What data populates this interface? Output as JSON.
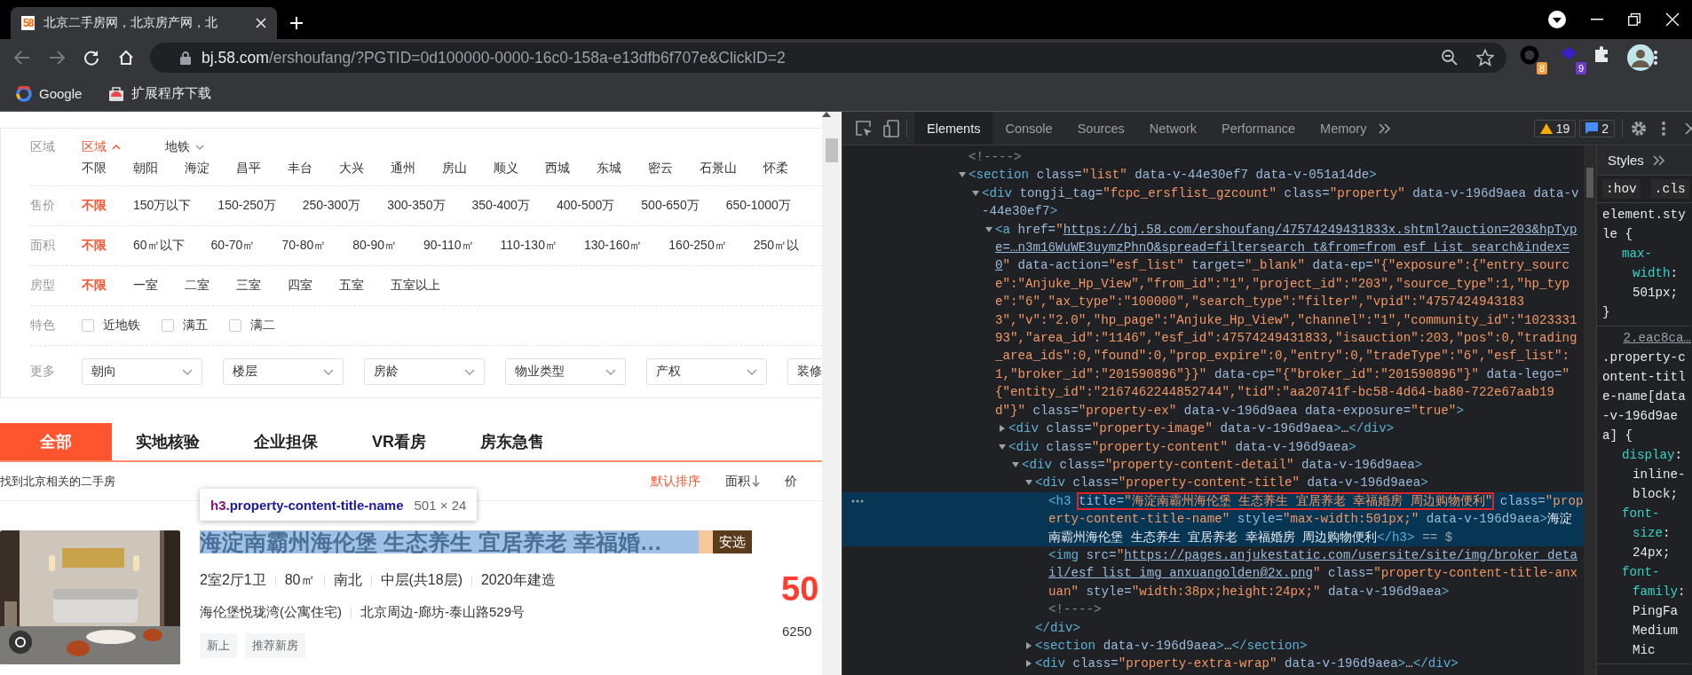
{
  "browser": {
    "tab": {
      "favicon_text": "58",
      "title": "北京二手房网，北京房产网，北"
    },
    "url": {
      "host": "bj.58.com",
      "path": "/ershoufang/?PGTID=0d100000-0000-16c0-158a-e13dfb6f707e&ClickID=2"
    },
    "extension_badges": [
      "8",
      "9"
    ],
    "bookmarks": [
      {
        "label": "Google",
        "kind": "google"
      },
      {
        "label": "扩展程序下载",
        "kind": "store"
      }
    ]
  },
  "filters": [
    {
      "label": "区域",
      "kind": "region",
      "tabs": [
        {
          "label": "区域",
          "selected": true
        },
        {
          "label": "地铁",
          "selected": false
        }
      ],
      "options": [
        {
          "label": "不限",
          "selected": false
        },
        {
          "label": "朝阳",
          "selected": false
        },
        {
          "label": "海淀",
          "selected": false
        },
        {
          "label": "昌平",
          "selected": false
        },
        {
          "label": "丰台",
          "selected": false
        },
        {
          "label": "大兴",
          "selected": false
        },
        {
          "label": "通州",
          "selected": false
        },
        {
          "label": "房山",
          "selected": false
        },
        {
          "label": "顺义",
          "selected": false
        },
        {
          "label": "西城",
          "selected": false
        },
        {
          "label": "东城",
          "selected": false
        },
        {
          "label": "密云",
          "selected": false
        },
        {
          "label": "石景山",
          "selected": false
        },
        {
          "label": "怀柔",
          "selected": false
        }
      ]
    },
    {
      "label": "售价",
      "kind": "options",
      "options": [
        {
          "label": "不限",
          "selected": true
        },
        {
          "label": "150万以下",
          "selected": false
        },
        {
          "label": "150-250万",
          "selected": false
        },
        {
          "label": "250-300万",
          "selected": false
        },
        {
          "label": "300-350万",
          "selected": false
        },
        {
          "label": "350-400万",
          "selected": false
        },
        {
          "label": "400-500万",
          "selected": false
        },
        {
          "label": "500-650万",
          "selected": false
        },
        {
          "label": "650-1000万",
          "selected": false
        }
      ]
    },
    {
      "label": "面积",
      "kind": "options",
      "options": [
        {
          "label": "不限",
          "selected": true
        },
        {
          "label": "60㎡以下",
          "selected": false
        },
        {
          "label": "60-70㎡",
          "selected": false
        },
        {
          "label": "70-80㎡",
          "selected": false
        },
        {
          "label": "80-90㎡",
          "selected": false
        },
        {
          "label": "90-110㎡",
          "selected": false
        },
        {
          "label": "110-130㎡",
          "selected": false
        },
        {
          "label": "130-160㎡",
          "selected": false
        },
        {
          "label": "160-250㎡",
          "selected": false
        },
        {
          "label": "250㎡以",
          "selected": false
        }
      ]
    },
    {
      "label": "房型",
      "kind": "options",
      "options": [
        {
          "label": "不限",
          "selected": true
        },
        {
          "label": "一室",
          "selected": false
        },
        {
          "label": "二室",
          "selected": false
        },
        {
          "label": "三室",
          "selected": false
        },
        {
          "label": "四室",
          "selected": false
        },
        {
          "label": "五室",
          "selected": false
        },
        {
          "label": "五室以上",
          "selected": false
        }
      ]
    },
    {
      "label": "特色",
      "kind": "checks",
      "options": [
        {
          "label": "近地铁",
          "checked": false
        },
        {
          "label": "满五",
          "checked": false
        },
        {
          "label": "满二",
          "checked": false
        }
      ]
    },
    {
      "label": "更多",
      "kind": "dropdowns",
      "options": [
        {
          "label": "朝向",
          "chevron": true
        },
        {
          "label": "楼层",
          "chevron": true
        },
        {
          "label": "房龄",
          "chevron": true
        },
        {
          "label": "物业类型",
          "chevron": true
        },
        {
          "label": "产权",
          "chevron": true
        },
        {
          "label": "装修"
        }
      ]
    }
  ],
  "list_tabs": [
    {
      "label": "全部",
      "selected": true
    },
    {
      "label": "实地核验",
      "selected": false
    },
    {
      "label": "企业担保",
      "selected": false
    },
    {
      "label": "VR看房",
      "selected": false
    },
    {
      "label": "房东急售",
      "selected": false
    }
  ],
  "sort_bar": {
    "summary": "找到北京相关的二手房",
    "sorts": [
      {
        "label": "默认排序",
        "selected": true,
        "kind": "plain"
      },
      {
        "label": "面积",
        "selected": false,
        "kind": "arrow"
      },
      {
        "label": "价",
        "selected": false,
        "kind": "plain"
      }
    ]
  },
  "inspect_tooltip": {
    "tag": "h3",
    "selector": ".property-content-title-name",
    "size": "501 × 24"
  },
  "listing": {
    "image": {
      "kind": "picture"
    },
    "title": "海淀南霸州海伦堡 生态养生 宜居养老 幸福婚…",
    "badge": "安选",
    "details": [
      "2室2厅1卫",
      "80㎡",
      "南北",
      "中层(共18层)",
      "2020年建造"
    ],
    "address": [
      "海伦堡悦珑湾(公寓住宅)",
      "北京周边-廊坊-泰山路529号"
    ],
    "tags": [
      "新上",
      "推荐新房"
    ],
    "price": "50",
    "unit_price": "6250"
  },
  "devtools": {
    "tabs": [
      {
        "label": "Elements",
        "selected": true
      },
      {
        "label": "Console",
        "selected": false
      },
      {
        "label": "Sources",
        "selected": false
      },
      {
        "label": "Network",
        "selected": false
      },
      {
        "label": "Performance",
        "selected": false
      },
      {
        "label": "Memory",
        "selected": false
      }
    ],
    "warnings": "19",
    "messages": "2",
    "dom": [
      {
        "segs": [
          {
            "kind": "comment",
            "text": "<!---->"
          }
        ],
        "selected": false
      },
      {
        "segs": [
          {
            "kind": "tag",
            "text": "<section"
          },
          {
            "kind": "attr",
            "text": " class="
          },
          {
            "kind": "value",
            "text": "\"list\""
          },
          {
            "kind": "attr",
            "text": " data-v-44e30ef7 data-v-051a14de"
          },
          {
            "kind": "tag",
            "text": ">"
          }
        ],
        "selected": false,
        "expanded": true,
        "children": [
          {
            "segs": [
              {
                "kind": "tag",
                "text": "<div"
              },
              {
                "kind": "attr",
                "text": " tongji_tag="
              },
              {
                "kind": "value",
                "text": "\"fcpc_ersflist_gzcount\""
              },
              {
                "kind": "attr",
                "text": " class="
              },
              {
                "kind": "value",
                "text": "\"property\""
              },
              {
                "kind": "attr",
                "text": " data-v-196d9aea data-v-44e30ef7"
              },
              {
                "kind": "tag",
                "text": ">"
              }
            ],
            "selected": false,
            "expanded": true,
            "children": [
              {
                "segs": [
                  {
                    "kind": "tag",
                    "text": "<a"
                  },
                  {
                    "kind": "attr",
                    "text": " href="
                  },
                  {
                    "kind": "value",
                    "text": "\""
                  },
                  {
                    "kind": "link",
                    "text": "https://bj.58.com/ershoufang/47574249431833x.shtml?auction=203&hpType=…n3m16WuWE3uymzPhnO&spread=filtersearch_t&from=from_esf_List_search&index=0"
                  },
                  {
                    "kind": "value",
                    "text": "\""
                  },
                  {
                    "kind": "attr",
                    "text": " data-action="
                  },
                  {
                    "kind": "value",
                    "text": "\"esf_list\""
                  },
                  {
                    "kind": "attr",
                    "text": " target="
                  },
                  {
                    "kind": "value",
                    "text": "\"_blank\""
                  },
                  {
                    "kind": "attr",
                    "text": " data-ep="
                  },
                  {
                    "kind": "value",
                    "text": "\"{\"exposure\":{\"entry_source\":\"Anjuke_Hp_View\",\"from_id\":\"1\",\"project_id\":\"203\",\"source_type\":1,\"hp_type\":\"6\",\"ax_type\":\"100000\",\"search_type\":\"filter\",\"vpid\":\"47574249431833\",\"v\":\"2.0\",\"hp_page\":\"Anjuke_Hp_View\",\"channel\":\"1\",\"community_id\":\"102333193\",\"area_id\":\"1146\",\"esf_id\":47574249431833,\"isauction\":203,\"pos\":0,\"trading_area_ids\":0,\"found\":0,\"prop_expire\":0,\"entry\":0,\"tradeType\":\"6\",\"esf_list\":1,\"broker_id\":\"201590896\"}}\""
                  },
                  {
                    "kind": "attr",
                    "text": " data-cp="
                  },
                  {
                    "kind": "value",
                    "text": "\"{\"broker_id\":\"201590896\"}\""
                  },
                  {
                    "kind": "attr",
                    "text": " data-lego="
                  },
                  {
                    "kind": "value",
                    "text": "\"{\"entity_id\":\"2167462244852744\",\"tid\":\"aa20741f-bc58-4d64-ba80-722e67aab19d\"}\""
                  },
                  {
                    "kind": "attr",
                    "text": " class="
                  },
                  {
                    "kind": "value",
                    "text": "\"property-ex\""
                  },
                  {
                    "kind": "attr",
                    "text": " data-v-196d9aea data-exposure="
                  },
                  {
                    "kind": "value",
                    "text": "\"true\""
                  },
                  {
                    "kind": "tag",
                    "text": ">"
                  }
                ],
                "selected": false,
                "expanded": true,
                "children": [
                  {
                    "segs": [
                      {
                        "kind": "tag",
                        "text": "<div"
                      },
                      {
                        "kind": "attr",
                        "text": " class="
                      },
                      {
                        "kind": "value",
                        "text": "\"property-image\""
                      },
                      {
                        "kind": "attr",
                        "text": " data-v-196d9aea"
                      },
                      {
                        "kind": "tag",
                        "text": ">"
                      },
                      {
                        "kind": "text",
                        "text": "…"
                      },
                      {
                        "kind": "tag",
                        "text": "</div>"
                      }
                    ],
                    "selected": false,
                    "expanded": false
                  },
                  {
                    "segs": [
                      {
                        "kind": "tag",
                        "text": "<div"
                      },
                      {
                        "kind": "attr",
                        "text": " class="
                      },
                      {
                        "kind": "value",
                        "text": "\"property-content\""
                      },
                      {
                        "kind": "attr",
                        "text": " data-v-196d9aea"
                      },
                      {
                        "kind": "tag",
                        "text": ">"
                      }
                    ],
                    "selected": false,
                    "expanded": true,
                    "children": [
                      {
                        "segs": [
                          {
                            "kind": "tag",
                            "text": "<div"
                          },
                          {
                            "kind": "attr",
                            "text": " class="
                          },
                          {
                            "kind": "value",
                            "text": "\"property-content-detail\""
                          },
                          {
                            "kind": "attr",
                            "text": " data-v-196d9aea"
                          },
                          {
                            "kind": "tag",
                            "text": ">"
                          }
                        ],
                        "selected": false,
                        "expanded": true,
                        "children": [
                          {
                            "segs": [
                              {
                                "kind": "tag",
                                "text": "<div"
                              },
                              {
                                "kind": "attr",
                                "text": " class="
                              },
                              {
                                "kind": "value",
                                "text": "\"property-content-title\""
                              },
                              {
                                "kind": "attr",
                                "text": " data-v-196d9aea"
                              },
                              {
                                "kind": "tag",
                                "text": ">"
                              }
                            ],
                            "selected": false,
                            "expanded": true,
                            "close": [
                              {
                                "kind": "tag",
                                "text": "</div>"
                              }
                            ],
                            "children": [
                              {
                                "segs": [
                                  {
                                    "kind": "tag",
                                    "text": "<h3 "
                                  },
                                  {
                                    "kind": "box",
                                    "parts": [
                                      {
                                        "kind": "attr",
                                        "text": "title="
                                      },
                                      {
                                        "kind": "value",
                                        "text": "\"海淀南霸州海伦堡 生态养生 宜居养老 幸福婚房 周边购物便利\""
                                      }
                                    ]
                                  },
                                  {
                                    "kind": "attr",
                                    "text": " class="
                                  },
                                  {
                                    "kind": "value",
                                    "text": "\"property-content-title-name\""
                                  },
                                  {
                                    "kind": "attr",
                                    "text": " style="
                                  },
                                  {
                                    "kind": "value",
                                    "text": "\"max-width:501px;\""
                                  },
                                  {
                                    "kind": "attr",
                                    "text": " data-v-196d9aea"
                                  },
                                  {
                                    "kind": "tag",
                                    "text": ">"
                                  },
                                  {
                                    "kind": "text",
                                    "text": "海淀南霸州海伦堡 生态养生 宜居养老 幸福婚房 周边购物便利"
                                  },
                                  {
                                    "kind": "tag",
                                    "text": "</h3>"
                                  },
                                  {
                                    "kind": "hint",
                                    "text": " == $"
                                  }
                                ],
                                "selected": true
                              },
                              {
                                "segs": [
                                  {
                                    "kind": "tag",
                                    "text": "<img"
                                  },
                                  {
                                    "kind": "attr",
                                    "text": " src="
                                  },
                                  {
                                    "kind": "value",
                                    "text": "\""
                                  },
                                  {
                                    "kind": "link",
                                    "text": "https://pages.anjukestatic.com/usersite/site/img/broker_detail/esf_list_img_anxuangolden@2x.png"
                                  },
                                  {
                                    "kind": "value",
                                    "text": "\""
                                  },
                                  {
                                    "kind": "attr",
                                    "text": " class="
                                  },
                                  {
                                    "kind": "value",
                                    "text": "\"property-content-title-anxuan\""
                                  },
                                  {
                                    "kind": "attr",
                                    "text": " style="
                                  },
                                  {
                                    "kind": "value",
                                    "text": "\"width:38px;height:24px;\""
                                  },
                                  {
                                    "kind": "attr",
                                    "text": " data-v-196d9aea"
                                  },
                                  {
                                    "kind": "tag",
                                    "text": ">"
                                  }
                                ],
                                "selected": false
                              },
                              {
                                "segs": [
                                  {
                                    "kind": "comment",
                                    "text": "<!---->"
                                  }
                                ],
                                "selected": false
                              }
                            ]
                          },
                          {
                            "segs": [
                              {
                                "kind": "tag",
                                "text": "<section"
                              },
                              {
                                "kind": "attr",
                                "text": " data-v-196d9aea"
                              },
                              {
                                "kind": "tag",
                                "text": ">"
                              },
                              {
                                "kind": "text",
                                "text": "…"
                              },
                              {
                                "kind": "tag",
                                "text": "</section>"
                              }
                            ],
                            "selected": false,
                            "expanded": false
                          },
                          {
                            "segs": [
                              {
                                "kind": "tag",
                                "text": "<div"
                              },
                              {
                                "kind": "attr",
                                "text": " class="
                              },
                              {
                                "kind": "value",
                                "text": "\"property-extra-wrap\""
                              },
                              {
                                "kind": "attr",
                                "text": " data-v-196d9aea"
                              },
                              {
                                "kind": "tag",
                                "text": ">"
                              },
                              {
                                "kind": "text",
                                "text": "…"
                              },
                              {
                                "kind": "tag",
                                "text": "</div>"
                              }
                            ],
                            "selected": false,
                            "expanded": false
                          }
                        ]
                      }
                    ]
                  }
                ]
              }
            ]
          }
        ]
      }
    ],
    "styles": {
      "tab": "Styles",
      "filters": [
        ":hov",
        ".cls"
      ],
      "rules": [
        {
          "selector": "element.style {",
          "decls": [
            {
              "prop": "max-width",
              "value": ": 501px;"
            }
          ],
          "close": "}"
        },
        {
          "source": "2.eac8ca…",
          "selector": ".property-content-title-name[data-v-196d9aea] {",
          "decls": [
            {
              "prop": "display",
              "value": ": inline-block;"
            },
            {
              "prop": "font-size",
              "value": ": 24px;"
            },
            {
              "prop": "font-family",
              "value": ": PingFa Medium Mic"
            }
          ]
        }
      ]
    }
  }
}
